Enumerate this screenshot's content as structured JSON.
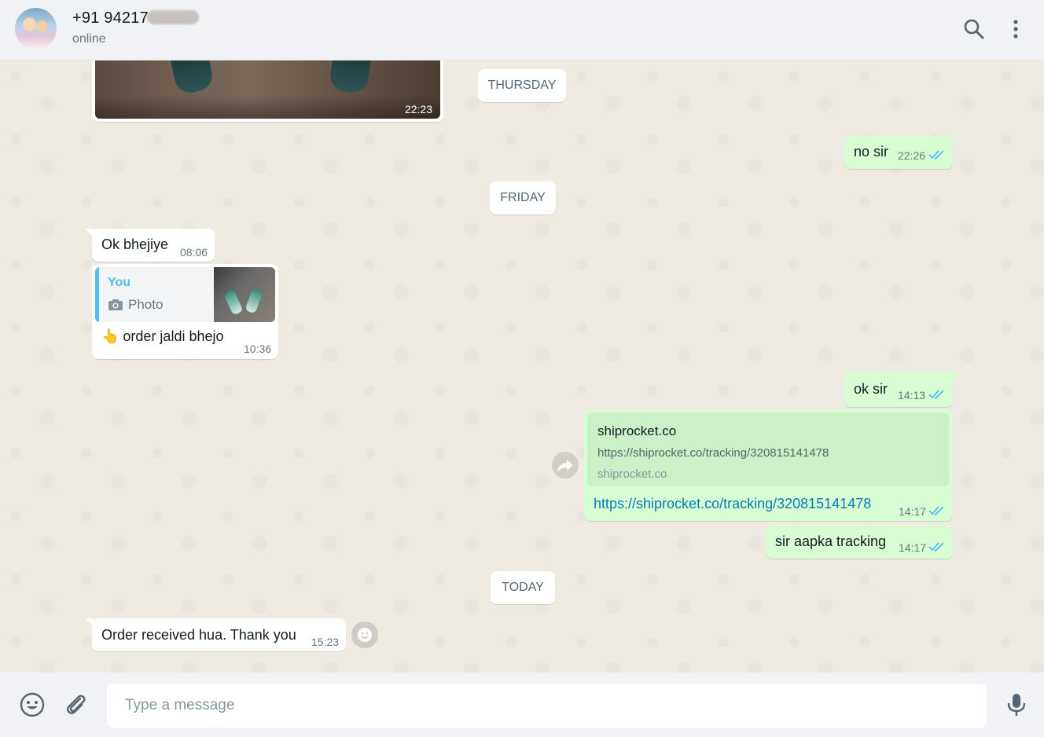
{
  "header": {
    "contact_name": "+91 94217",
    "status": "online",
    "icons": [
      "search-icon",
      "more-vertical-icon"
    ]
  },
  "chat": {
    "image_message": {
      "time": "22:23"
    },
    "dates": {
      "thursday": "THURSDAY",
      "friday": "FRIDAY",
      "today": "TODAY"
    },
    "messages": [
      {
        "id": "m1",
        "direction": "out",
        "text": "no sir",
        "time": "22:26",
        "status": "read"
      },
      {
        "id": "m2",
        "direction": "in",
        "text": "Ok bhejiye",
        "time": "08:06"
      },
      {
        "id": "m3",
        "direction": "in",
        "quote_author": "You",
        "quote_type": "Photo",
        "text": "👆 order jaldi bhejo",
        "time": "10:36"
      },
      {
        "id": "m4",
        "direction": "out",
        "text": "ok sir",
        "time": "14:13",
        "status": "read"
      },
      {
        "id": "m5",
        "direction": "out",
        "preview_title": "shiprocket.co",
        "preview_url": "https://shiprocket.co/tracking/320815141478",
        "preview_domain": "shiprocket.co",
        "text": "https://shiprocket.co/tracking/320815141478",
        "time": "14:17",
        "status": "read"
      },
      {
        "id": "m6",
        "direction": "out",
        "text": "sir aapka tracking",
        "time": "14:17",
        "status": "read"
      },
      {
        "id": "m7",
        "direction": "in",
        "text": "Order received hua. Thank you",
        "time": "15:23"
      }
    ]
  },
  "footer": {
    "placeholder": "Type a message",
    "icons": [
      "emoji-icon",
      "attach-icon",
      "microphone-icon"
    ]
  },
  "colors": {
    "incoming_bubble": "#ffffff",
    "outgoing_bubble": "#d9fdd3",
    "read_ticks": "#53bdeb",
    "link": "#027eb5",
    "chat_background": "#efeae2"
  }
}
